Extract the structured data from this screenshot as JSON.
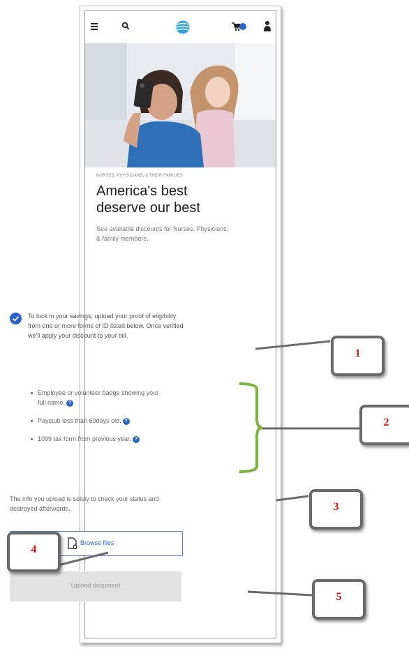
{
  "promo": {
    "eyebrow": "NURSES, PHYSICIANS, & THEIR FAMILIES",
    "headline_line1": "America's best",
    "headline_line2": "deserve our best",
    "subtitle": "See available discounts for Nurses, Physicians, & family members."
  },
  "notice": {
    "text": "To lock in your savings, upload your proof of eligibility from one or more forms of ID listed below. Once verified we'll apply your discount to your bill."
  },
  "id_options": [
    {
      "label": "Employee or volunteer badge showing your full name."
    },
    {
      "label": "Paystub less than 60days old."
    },
    {
      "label": "1099 tax form from previous year."
    }
  ],
  "info_text": "The info you upload is solely to check your status and destroyed afterwards.",
  "buttons": {
    "browse_label": "Browse files",
    "upload_label": "Upload document"
  },
  "callouts": [
    "1",
    "2",
    "3",
    "4",
    "5"
  ],
  "colors": {
    "accent": "#2b64c6",
    "callout_number": "#c9191d",
    "bracket": "#7cb342"
  }
}
